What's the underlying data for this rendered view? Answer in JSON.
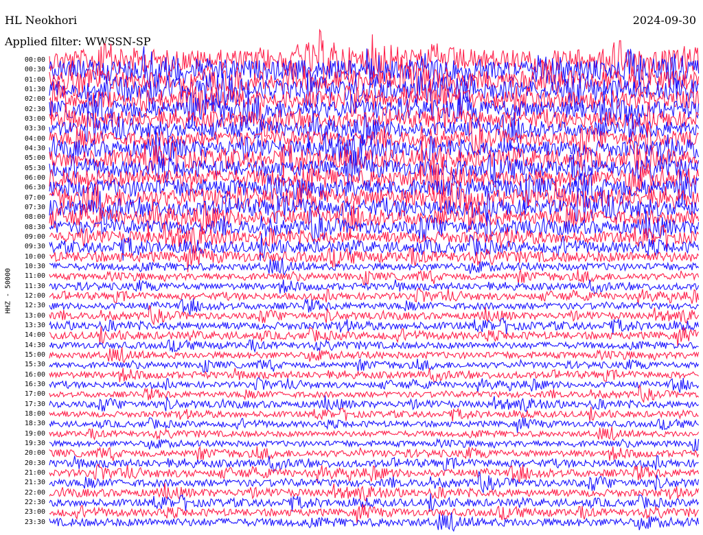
{
  "header": {
    "station": "HL Neokhori",
    "date": "2024-09-30",
    "filter": "Applied filter: WWSSN-SP"
  },
  "channel_label": "HHZ - 50000",
  "colors": {
    "trace_a": "#ff1f4a",
    "trace_b": "#1a13ff",
    "background": "#ffffff"
  },
  "chart_data": {
    "type": "line",
    "title": "HL Neokhori",
    "subtitle": "2024-09-30",
    "ylabel": "HHZ - 50000",
    "xlabel": "",
    "row_labels": [
      "00:00",
      "00:30",
      "01:00",
      "01:30",
      "02:00",
      "02:30",
      "03:00",
      "03:30",
      "04:00",
      "04:30",
      "05:00",
      "05:30",
      "06:00",
      "06:30",
      "07:00",
      "07:30",
      "08:00",
      "08:30",
      "09:00",
      "09:30",
      "10:00",
      "10:30",
      "11:00",
      "11:30",
      "12:00",
      "12:30",
      "13:00",
      "13:30",
      "14:00",
      "14:30",
      "15:00",
      "15:30",
      "16:00",
      "16:30",
      "17:00",
      "17:30",
      "18:00",
      "18:30",
      "19:00",
      "19:30",
      "20:00",
      "20:30",
      "21:00",
      "21:30",
      "22:00",
      "22:30",
      "23:00",
      "23:30"
    ],
    "series": [
      {
        "values": [
          "#ff1f4a",
          "#1a13ff"
        ]
      }
    ],
    "row_amplitude": [
      3.0,
      2.8,
      2.6,
      2.6,
      2.4,
      2.4,
      2.2,
      2.0,
      2.0,
      2.2,
      2.4,
      2.2,
      2.4,
      2.4,
      2.4,
      2.2,
      2.0,
      1.8,
      1.6,
      1.5,
      1.4,
      1.0,
      0.9,
      0.9,
      0.9,
      0.9,
      0.9,
      1.0,
      1.0,
      0.9,
      0.9,
      0.8,
      0.9,
      0.8,
      0.8,
      0.9,
      0.8,
      0.8,
      0.8,
      0.8,
      0.9,
      1.0,
      1.0,
      1.0,
      1.0,
      1.0,
      1.0,
      1.1
    ],
    "grid": false
  }
}
